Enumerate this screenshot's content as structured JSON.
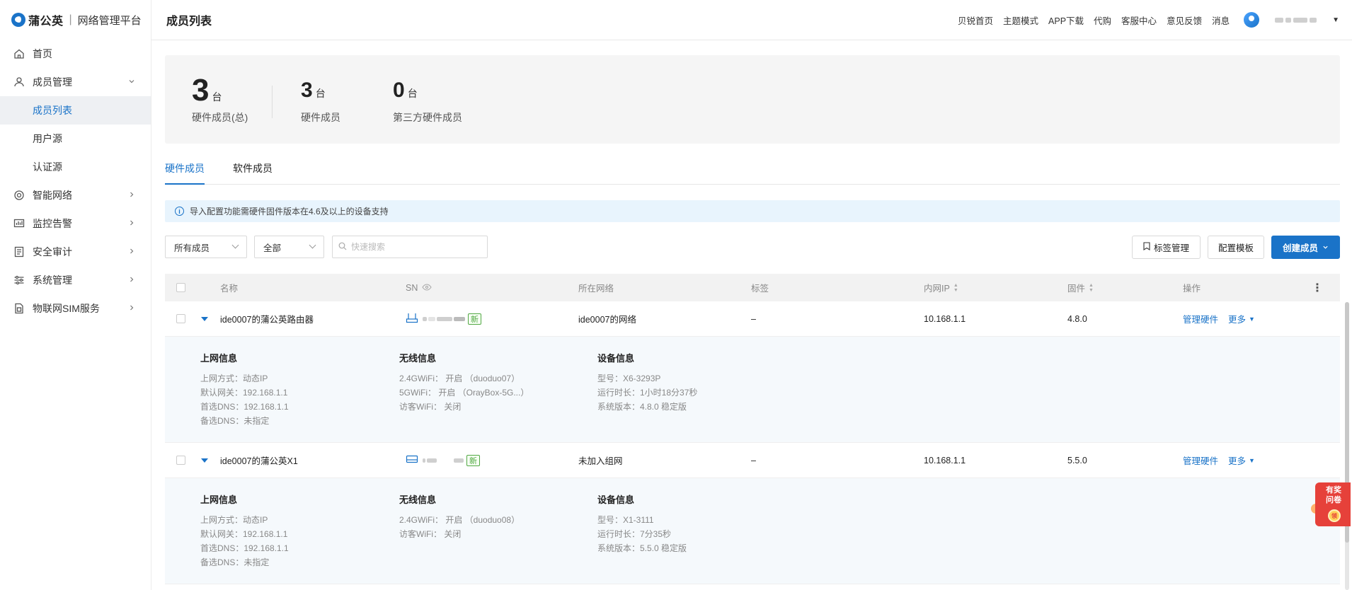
{
  "app": {
    "brand": "蒲公英",
    "subtitle": "网络管理平台"
  },
  "sidebar": {
    "items": [
      {
        "label": "首页",
        "icon": "home-icon"
      },
      {
        "label": "成员管理",
        "icon": "user-icon"
      },
      {
        "label": "成员列表"
      },
      {
        "label": "用户源"
      },
      {
        "label": "认证源"
      },
      {
        "label": "智能网络",
        "icon": "network-icon"
      },
      {
        "label": "监控告警",
        "icon": "monitor-icon"
      },
      {
        "label": "安全审计",
        "icon": "audit-icon"
      },
      {
        "label": "系统管理",
        "icon": "settings-icon"
      },
      {
        "label": "物联网SIM服务",
        "icon": "sim-icon"
      }
    ]
  },
  "header": {
    "title": "成员列表",
    "links": [
      "贝锐首页",
      "主题模式",
      "APP下载",
      "代购",
      "客服中心",
      "意见反馈",
      "消息"
    ]
  },
  "stats": [
    {
      "value": "3",
      "unit": "台",
      "label": "硬件成员(总)"
    },
    {
      "value": "3",
      "unit": "台",
      "label": "硬件成员"
    },
    {
      "value": "0",
      "unit": "台",
      "label": "第三方硬件成员"
    }
  ],
  "tabs": [
    "硬件成员",
    "软件成员"
  ],
  "notice": "导入配置功能需硬件固件版本在4.6及以上的设备支持",
  "filters": {
    "member_select": "所有成员",
    "type_select": "全部",
    "search_placeholder": "快速搜索"
  },
  "toolbar": {
    "tag_manage": "标签管理",
    "config_template": "配置模板",
    "create_member": "创建成员"
  },
  "table": {
    "headers": {
      "name": "名称",
      "sn": "SN",
      "network": "所在网络",
      "tag": "标签",
      "ip": "内网IP",
      "firmware": "固件",
      "actions": "操作"
    },
    "rows": [
      {
        "name": "ide0007的蒲公英路由器",
        "badge": "新",
        "network": "ide0007的网络",
        "tag": "–",
        "ip": "10.168.1.1",
        "firmware": "4.8.0",
        "action_manage": "管理硬件",
        "action_more": "更多",
        "detail": {
          "internet_title": "上网信息",
          "internet": [
            "上网方式：动态IP",
            "默认网关：192.168.1.1",
            "首选DNS：192.168.1.1",
            "备选DNS：未指定"
          ],
          "wireless_title": "无线信息",
          "wireless": [
            "2.4GWiFi： 开启 （duoduo07）",
            "5GWiFi： 开启 （OrayBox-5G...）",
            "访客WiFi： 关闭"
          ],
          "device_title": "设备信息",
          "device": [
            "型号：X6-3293P",
            "运行时长：1小时18分37秒",
            "系统版本：4.8.0 稳定版"
          ]
        }
      },
      {
        "name": "ide0007的蒲公英X1",
        "badge": "新",
        "network": "未加入组网",
        "tag": "–",
        "ip": "10.168.1.1",
        "firmware": "5.5.0",
        "action_manage": "管理硬件",
        "action_more": "更多",
        "detail": {
          "internet_title": "上网信息",
          "internet": [
            "上网方式：动态IP",
            "默认网关：192.168.1.1",
            "首选DNS：192.168.1.1",
            "备选DNS：未指定"
          ],
          "wireless_title": "无线信息",
          "wireless": [
            "2.4GWiFi： 开启 （duoduo08）",
            "访客WiFi： 关闭"
          ],
          "device_title": "设备信息",
          "device": [
            "型号：X1-3111",
            "运行时长：7分35秒",
            "系统版本：5.5.0 稳定版"
          ]
        }
      }
    ]
  },
  "survey": {
    "text": "有奖问卷",
    "coin": "领"
  },
  "colors": {
    "accent": "#1a73c8",
    "badge_green": "#52a844",
    "notice_bg": "#e8f4fd",
    "survey_red": "#e6413a"
  }
}
